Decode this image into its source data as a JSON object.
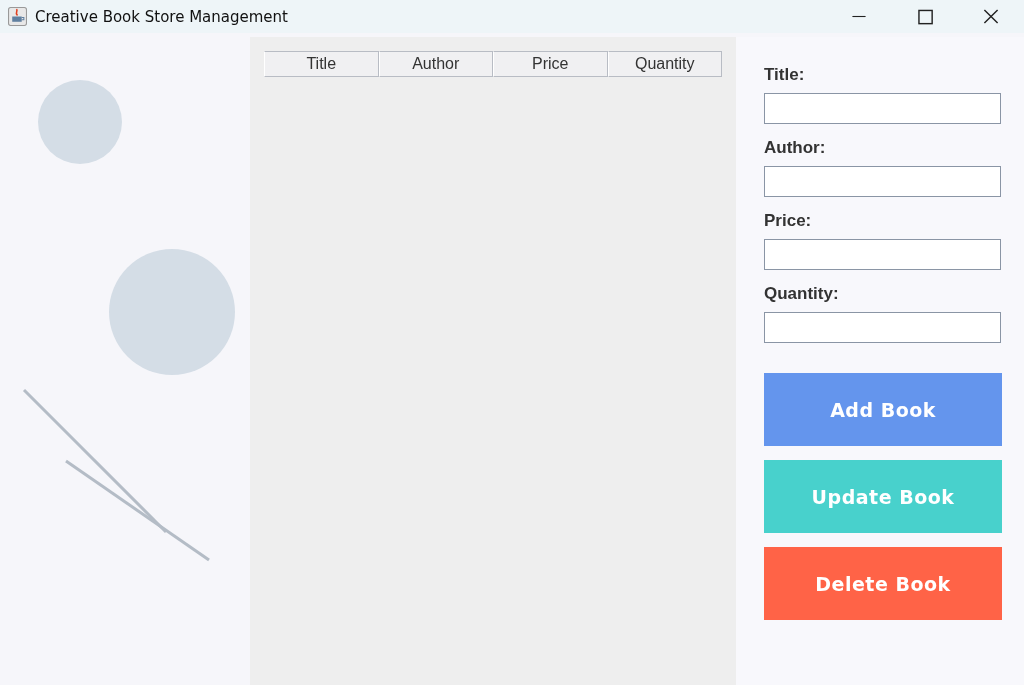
{
  "window": {
    "title": "Creative Book Store Management"
  },
  "table": {
    "columns": [
      "Title",
      "Author",
      "Price",
      "Quantity"
    ]
  },
  "form": {
    "fields": [
      {
        "label": "Title:"
      },
      {
        "label": "Author:"
      },
      {
        "label": "Price:"
      },
      {
        "label": "Quantity:"
      }
    ],
    "buttons": [
      {
        "label": "Add Book",
        "color": "#6495ed"
      },
      {
        "label": "Update Book",
        "color": "#48d1cc"
      },
      {
        "label": "Delete Book",
        "color": "#ff6347"
      }
    ]
  }
}
